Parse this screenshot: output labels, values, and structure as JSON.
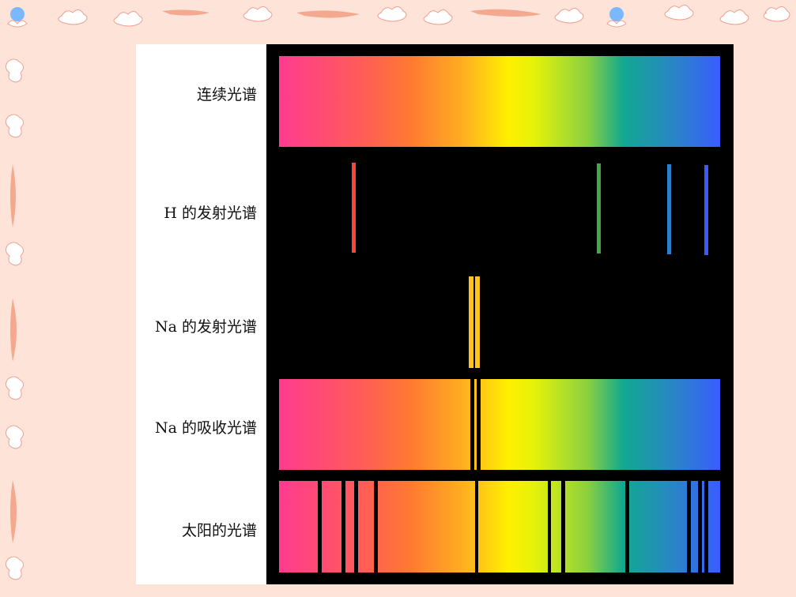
{
  "labels": {
    "continuous": "连续光谱",
    "h_emission": "H 的发射光谱",
    "na_emission": "Na 的发射光谱",
    "na_absorption": "Na 的吸收光谱",
    "solar": "太阳的光谱"
  },
  "colors": {
    "background": "#fde3d8",
    "panel": "#000000",
    "label_panel": "#ffffff",
    "h_red": "#ff4040",
    "h_green": "#3faa45",
    "h_blue1": "#2a7fc8",
    "h_blue2": "#3a5aff",
    "na_yellow": "#ffc41a"
  },
  "spectra": {
    "h_lines_fraction": [
      0.165,
      0.72,
      0.88,
      0.965
    ],
    "na_lines_fraction": [
      0.43,
      0.445
    ],
    "solar_dark_fraction": [
      0.087,
      0.142,
      0.17,
      0.215,
      0.445,
      0.61,
      0.64,
      0.785,
      0.925,
      0.95,
      0.965
    ]
  },
  "decor": {
    "top_border": [
      "sun-icon",
      "cloud-icon",
      "squiggle",
      "cloud-icon",
      "squiggle",
      "cloud-icon",
      "sun-icon",
      "cloud-icon"
    ],
    "left_border": [
      "cloud-icon",
      "squiggle",
      "cloud-icon",
      "squiggle",
      "cloud-icon"
    ]
  }
}
